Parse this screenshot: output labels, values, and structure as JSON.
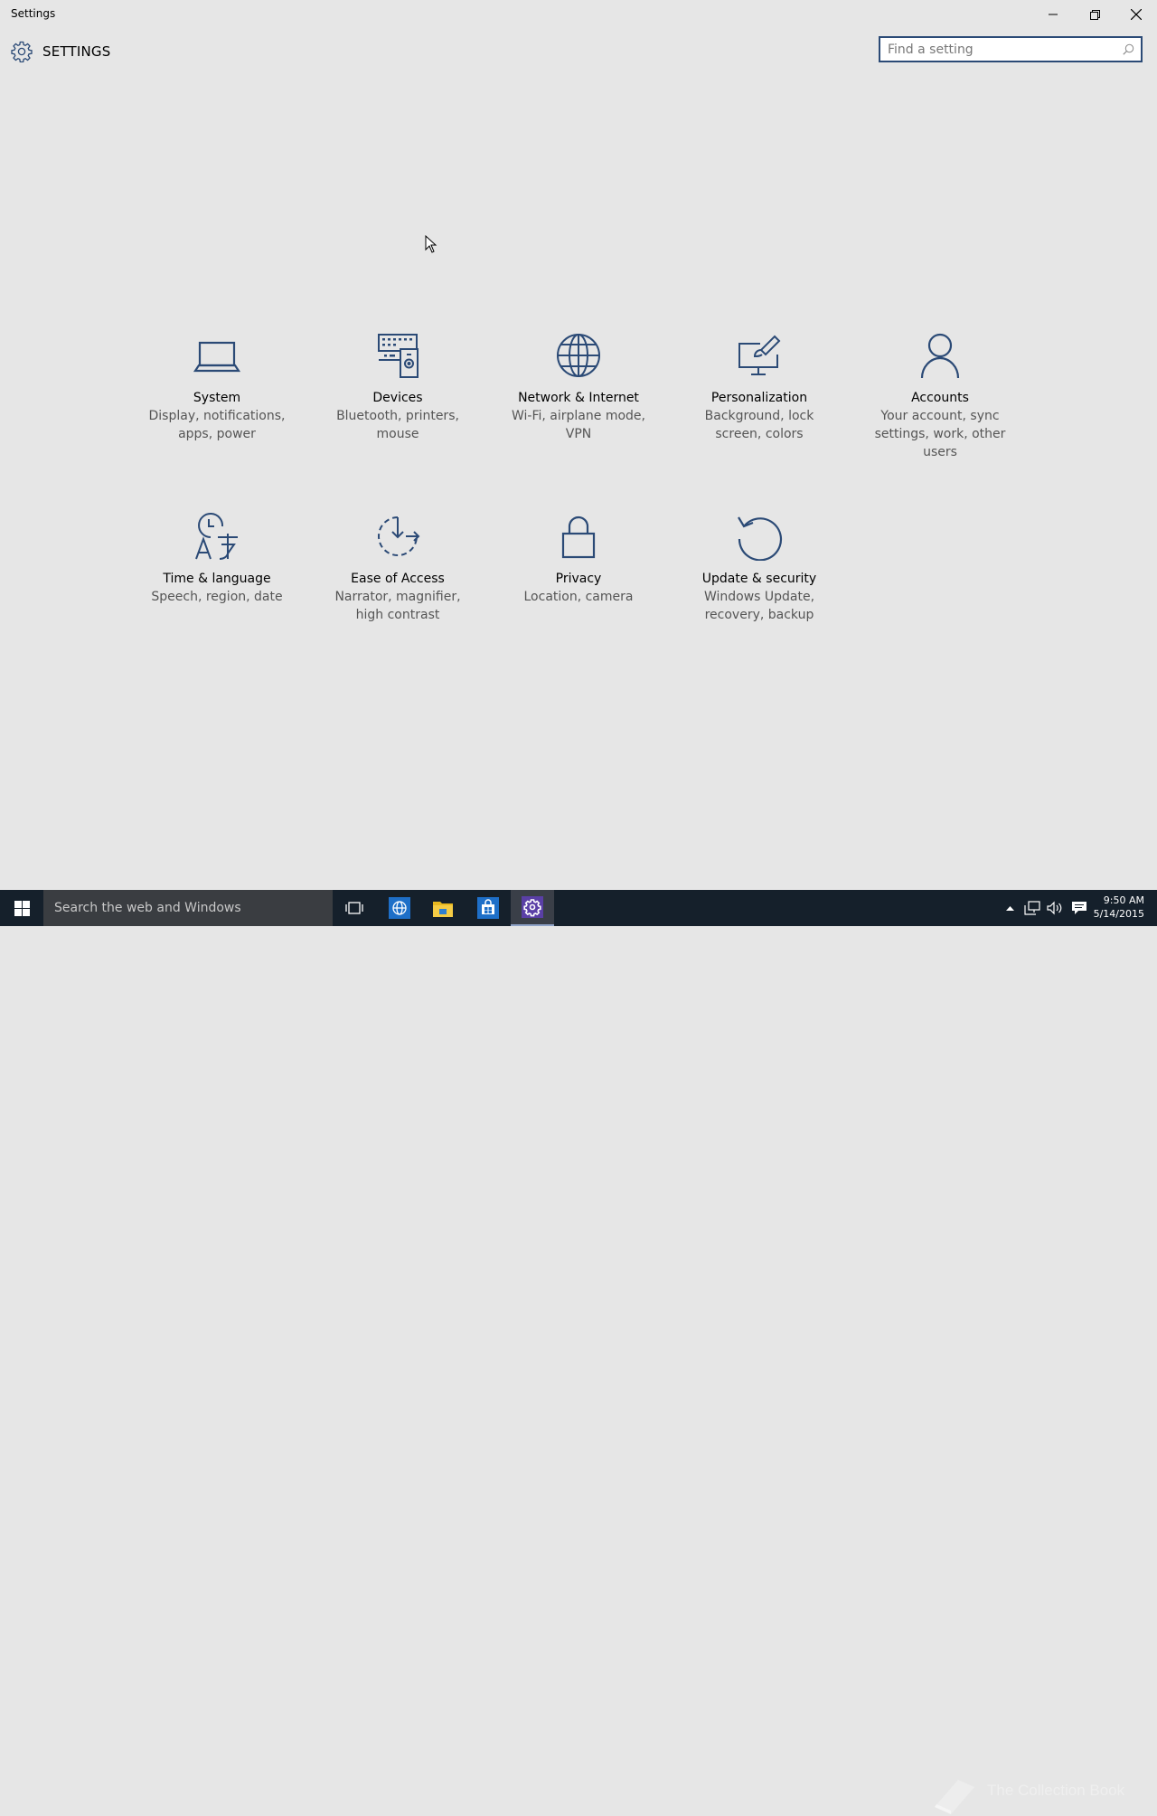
{
  "window": {
    "title": "Settings",
    "minimize_icon": "minimize-icon",
    "restore_icon": "restore-icon",
    "close_icon": "close-icon"
  },
  "header": {
    "icon": "gear-icon",
    "title": "SETTINGS"
  },
  "search": {
    "placeholder": "Find a setting",
    "value": "",
    "icon": "search-icon"
  },
  "categories": [
    {
      "name": "System",
      "desc": "Display, notifications, apps, power",
      "icon": "laptop-icon"
    },
    {
      "name": "Devices",
      "desc": "Bluetooth, printers, mouse",
      "icon": "keyboard-speaker-icon"
    },
    {
      "name": "Network & Internet",
      "desc": "Wi-Fi, airplane mode, VPN",
      "icon": "globe-icon"
    },
    {
      "name": "Personalization",
      "desc": "Background, lock screen, colors",
      "icon": "paintbrush-monitor-icon"
    },
    {
      "name": "Accounts",
      "desc": "Your account, sync settings, work, other users",
      "icon": "person-icon"
    },
    {
      "name": "Time & language",
      "desc": "Speech, region, date",
      "icon": "clock-language-icon"
    },
    {
      "name": "Ease of Access",
      "desc": "Narrator, magnifier, high contrast",
      "icon": "ease-of-access-icon"
    },
    {
      "name": "Privacy",
      "desc": "Location, camera",
      "icon": "lock-icon"
    },
    {
      "name": "Update & security",
      "desc": "Windows Update, recovery, backup",
      "icon": "refresh-icon"
    }
  ],
  "taskbar": {
    "search_text": "Search the web and Windows",
    "pinned": [
      "task-view-icon",
      "internet-explorer-icon",
      "file-explorer-icon",
      "store-icon",
      "settings-icon"
    ],
    "watermark": "The Collection Book",
    "time": "9:50 AM",
    "date": "5/14/2015"
  },
  "colors": {
    "accent": "#2b4a76",
    "background": "#e6e6e6",
    "taskbar": "#15202b"
  }
}
